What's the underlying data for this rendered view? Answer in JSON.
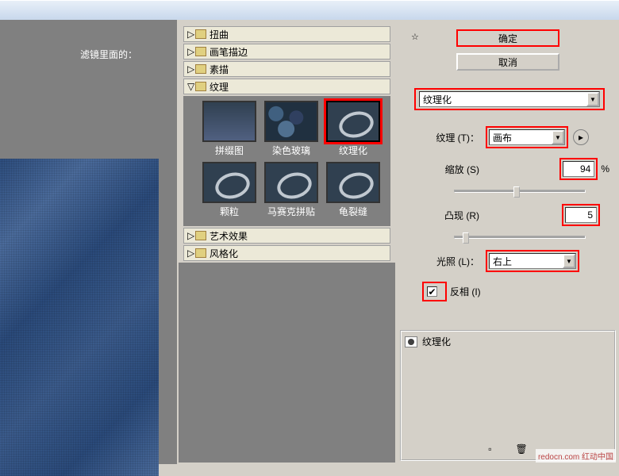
{
  "preview_label": "滤镜里面的：",
  "categories": {
    "distort": "扭曲",
    "brush": "画笔描边",
    "sketch": "素描",
    "texture": "纹理",
    "artistic": "艺术效果",
    "stylize": "风格化"
  },
  "texture_thumbs": [
    {
      "label": "拼缀图"
    },
    {
      "label": "染色玻璃"
    },
    {
      "label": "纹理化"
    },
    {
      "label": "颗粒"
    },
    {
      "label": "马赛克拼贴"
    },
    {
      "label": "龟裂缝"
    }
  ],
  "buttons": {
    "ok": "确定",
    "cancel": "取消"
  },
  "filter_select": "纹理化",
  "params": {
    "texture_label": "纹理 (T)：",
    "texture_value": "画布",
    "scale_label": "缩放 (S)",
    "scale_value": "94",
    "relief_label": "凸现 (R)",
    "relief_value": "5",
    "light_label": "光照 (L)：",
    "light_value": "右上",
    "invert_label": "反相 (I)"
  },
  "effect_layer": "纹理化",
  "watermark": "redocn.com\n红动中国"
}
